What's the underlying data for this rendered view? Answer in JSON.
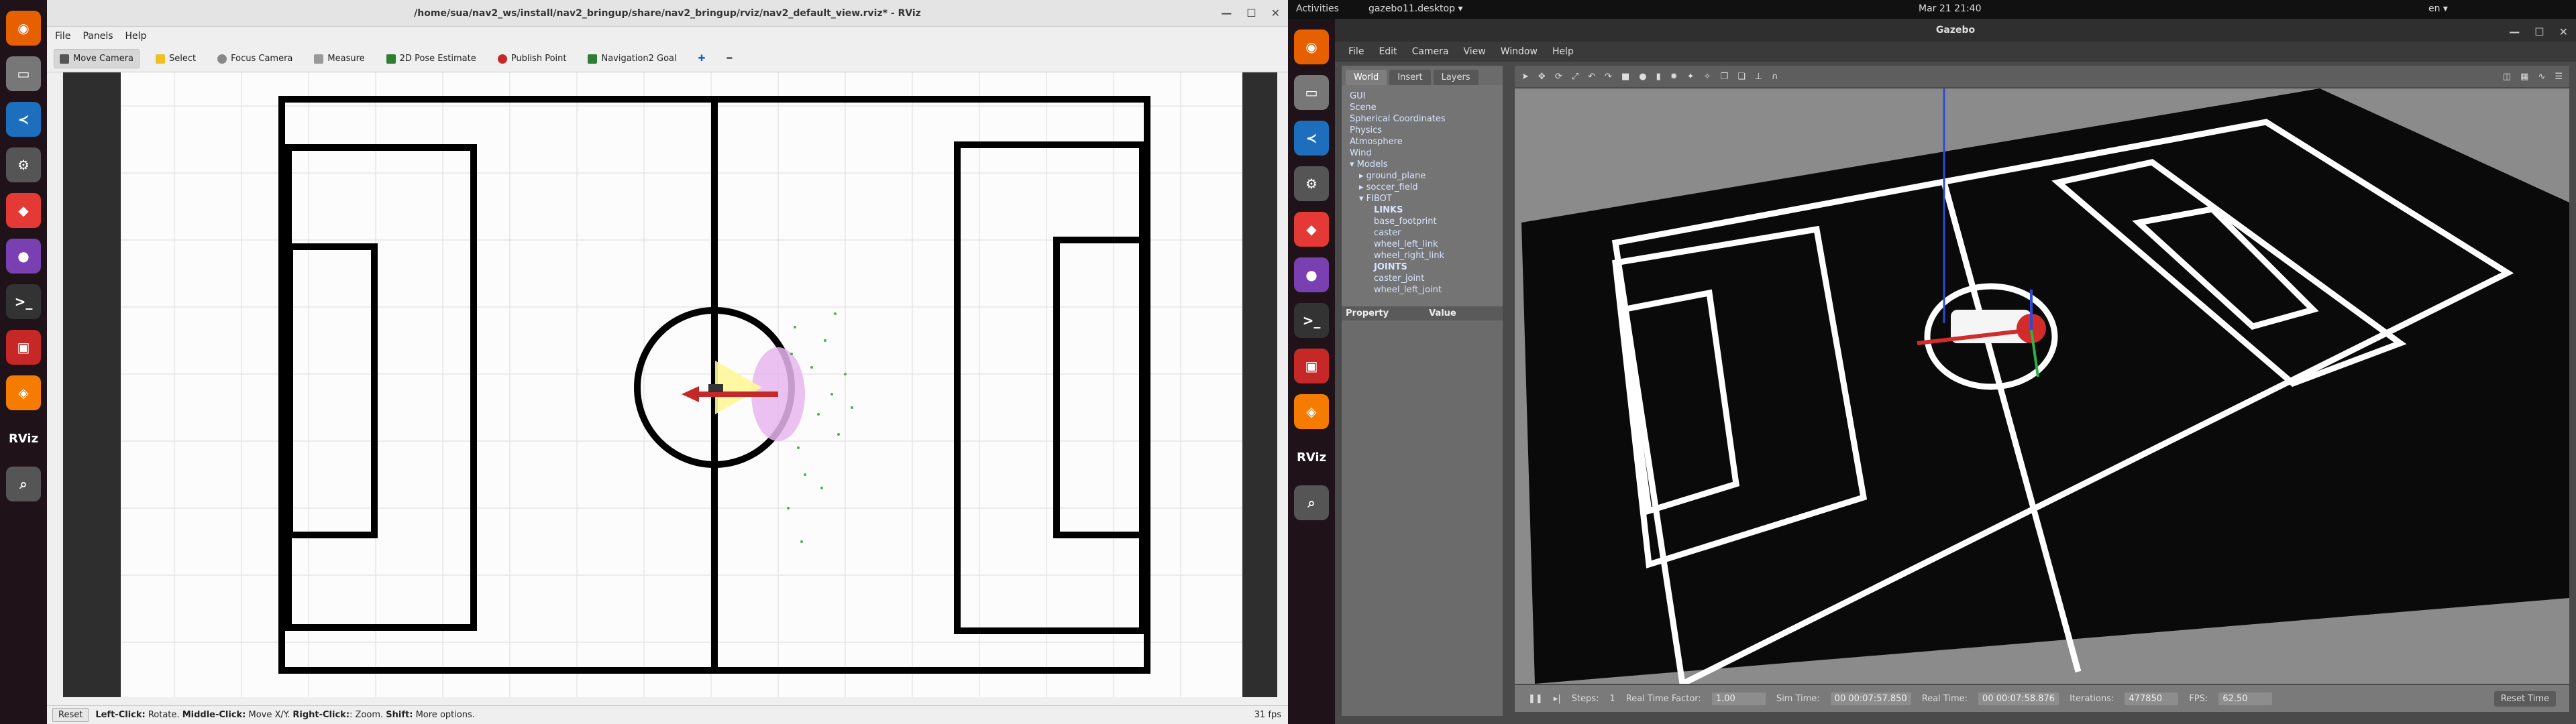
{
  "left": {
    "dock_apps": [
      "firefox-icon",
      "files-icon",
      "vscode-icon",
      "settings-icon",
      "anydesk-icon",
      "github-icon",
      "terminal-icon",
      "monitor-icon",
      "layers-icon",
      "rviz-icon",
      "search-icon"
    ],
    "dock_rviz_label": "RViz",
    "window_title": "/home/sua/nav2_ws/install/nav2_bringup/share/nav2_bringup/rviz/nav2_default_view.rviz* - RViz",
    "menu": [
      "File",
      "Panels",
      "Help"
    ],
    "tools": [
      "Move Camera",
      "Select",
      "Focus Camera",
      "Measure",
      "2D Pose Estimate",
      "Publish Point",
      "Navigation2 Goal"
    ],
    "status": {
      "reset": "Reset",
      "hint_1_bold": "Left-Click:",
      "hint_1": "Rotate.",
      "hint_2_bold": "Middle-Click:",
      "hint_2": "Move X/Y.",
      "hint_3_bold": "Right-Click:",
      "hint_3": ": Zoom.",
      "hint_4_bold": "Shift:",
      "hint_4": "More options.",
      "fps": "31 fps"
    }
  },
  "topbar": {
    "activities": "Activities",
    "app": "gazebo11.desktop ▾",
    "clock": "Mar 21  21:40",
    "lang": "en ▾"
  },
  "right": {
    "dock_apps": [
      "firefox-icon",
      "files-icon",
      "vscode-icon",
      "settings-icon",
      "anydesk-icon",
      "github-icon",
      "terminal-icon",
      "monitor-icon",
      "layers-icon",
      "rviz-icon",
      "search-icon"
    ],
    "dock_rviz_label": "RViz",
    "window_title": "Gazebo",
    "menu": [
      "File",
      "Edit",
      "Camera",
      "View",
      "Window",
      "Help"
    ],
    "tabs": [
      "World",
      "Insert",
      "Layers"
    ],
    "tree": [
      "GUI",
      "Scene",
      "Spherical Coordinates",
      "Physics",
      "Atmosphere",
      "Wind",
      "▾ Models",
      "▸ ground_plane",
      "▸ soccer_field",
      "▾ FIBOT",
      "LINKS",
      "base_footprint",
      "caster",
      "wheel_left_link",
      "wheel_right_link",
      "JOINTS",
      "caster_joint",
      "wheel_left_joint"
    ],
    "prop_header": [
      "Property",
      "Value"
    ],
    "bottom": {
      "steps_label": "Steps:",
      "steps_value": "1",
      "rtf_label": "Real Time Factor:",
      "rtf_value": "1.00",
      "sim_label": "Sim Time:",
      "sim_value": "00 00:07:57.850",
      "real_label": "Real Time:",
      "real_value": "00 00:07:58.876",
      "iter_label": "Iterations:",
      "iter_value": "477850",
      "fps_label": "FPS:",
      "fps_value": "62.50",
      "reset_time": "Reset Time"
    }
  }
}
